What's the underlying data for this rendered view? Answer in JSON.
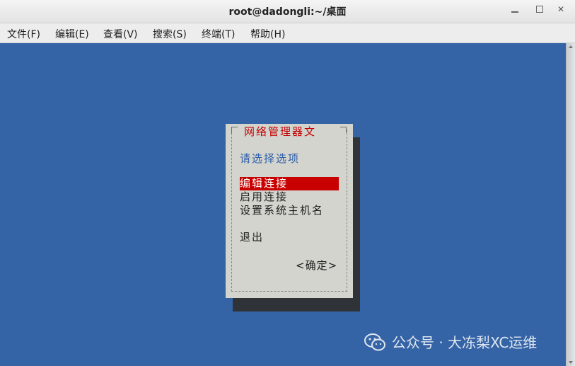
{
  "window": {
    "title": "root@dadongli:~/桌面"
  },
  "menubar": {
    "items": [
      {
        "label": "文件(F)"
      },
      {
        "label": "编辑(E)"
      },
      {
        "label": "查看(V)"
      },
      {
        "label": "搜索(S)"
      },
      {
        "label": "终端(T)"
      },
      {
        "label": "帮助(H)"
      }
    ]
  },
  "dialog": {
    "title": "网络管理器文",
    "prompt": "请选择选项",
    "options": [
      {
        "label": "编辑连接",
        "selected": true
      },
      {
        "label": "启用连接",
        "selected": false
      },
      {
        "label": "设置系统主机名",
        "selected": false
      },
      {
        "label": "退出",
        "selected": false
      }
    ],
    "ok_button": "<确定>"
  },
  "watermark": {
    "text": "公众号 · 大冻梨XC运维"
  },
  "colors": {
    "terminal_bg": "#3564a6",
    "dialog_bg": "#d4d4ce",
    "title_red": "#c30000",
    "prompt_blue": "#2c5ea8",
    "selection_red": "#c80000"
  }
}
